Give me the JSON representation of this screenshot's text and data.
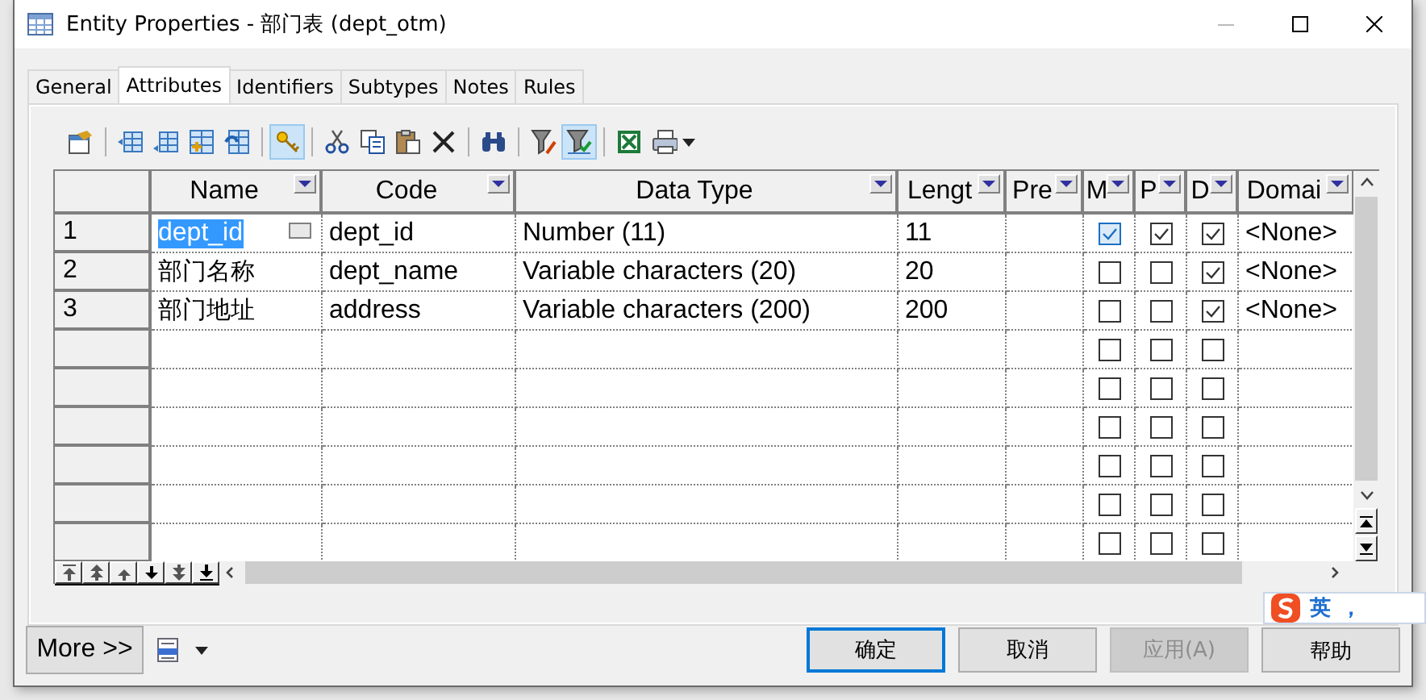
{
  "window": {
    "title": "Entity Properties - 部门表 (dept_otm)"
  },
  "tabs": [
    {
      "label": "General",
      "selected": false
    },
    {
      "label": "Attributes",
      "selected": true
    },
    {
      "label": "Identifiers",
      "selected": false
    },
    {
      "label": "Subtypes",
      "selected": false
    },
    {
      "label": "Notes",
      "selected": false
    },
    {
      "label": "Rules",
      "selected": false
    }
  ],
  "toolbar": [
    {
      "kind": "properties",
      "pressed": false
    },
    {
      "kind": "separator"
    },
    {
      "kind": "insert-row",
      "pressed": false
    },
    {
      "kind": "add-row",
      "pressed": false
    },
    {
      "kind": "add-table",
      "pressed": false
    },
    {
      "kind": "reuse",
      "pressed": false
    },
    {
      "kind": "separator"
    },
    {
      "kind": "key",
      "pressed": true
    },
    {
      "kind": "separator"
    },
    {
      "kind": "cut",
      "pressed": false
    },
    {
      "kind": "copy",
      "pressed": false
    },
    {
      "kind": "paste",
      "pressed": false
    },
    {
      "kind": "delete",
      "pressed": false
    },
    {
      "kind": "separator"
    },
    {
      "kind": "find",
      "pressed": false
    },
    {
      "kind": "separator"
    },
    {
      "kind": "filter-edit",
      "pressed": false
    },
    {
      "kind": "filter",
      "pressed": true
    },
    {
      "kind": "separator"
    },
    {
      "kind": "spreadsheet",
      "pressed": false
    },
    {
      "kind": "print",
      "pressed": false
    }
  ],
  "table": {
    "columns": [
      "Name",
      "Code",
      "Data Type",
      "Lengt",
      "Pre",
      "M",
      "P",
      "D",
      "Domai"
    ],
    "rows": [
      {
        "number": "1",
        "name": "dept_id",
        "code": "dept_id",
        "data_type": "Number (11)",
        "length": "11",
        "m": true,
        "p": true,
        "d": true,
        "domain": "<None>",
        "selected": true
      },
      {
        "number": "2",
        "name": "部门名称",
        "code": "dept_name",
        "data_type": "Variable characters (20)",
        "length": "20",
        "m": false,
        "p": false,
        "d": true,
        "domain": "<None>",
        "selected": false
      },
      {
        "number": "3",
        "name": "部门地址",
        "code": "address",
        "data_type": "Variable characters (200)",
        "length": "200",
        "m": false,
        "p": false,
        "d": true,
        "domain": "<None>",
        "selected": false
      },
      {
        "m": false,
        "p": false,
        "d": false,
        "selected": false
      },
      {
        "m": false,
        "p": false,
        "d": false,
        "selected": false
      },
      {
        "m": false,
        "p": false,
        "d": false,
        "selected": false
      },
      {
        "m": false,
        "p": false,
        "d": false,
        "selected": false
      },
      {
        "m": false,
        "p": false,
        "d": false,
        "selected": false
      },
      {
        "m": false,
        "p": false,
        "d": false,
        "selected": false
      }
    ]
  },
  "more_button": "More >>",
  "buttons": [
    {
      "label": "确定",
      "default": true,
      "disabled": false
    },
    {
      "label": "取消",
      "default": false,
      "disabled": false
    },
    {
      "label": "应用(A)",
      "default": false,
      "disabled": true
    },
    {
      "label": "帮助",
      "default": false,
      "disabled": false
    }
  ],
  "ime": {
    "mode": "英",
    "punctuation": "，"
  }
}
